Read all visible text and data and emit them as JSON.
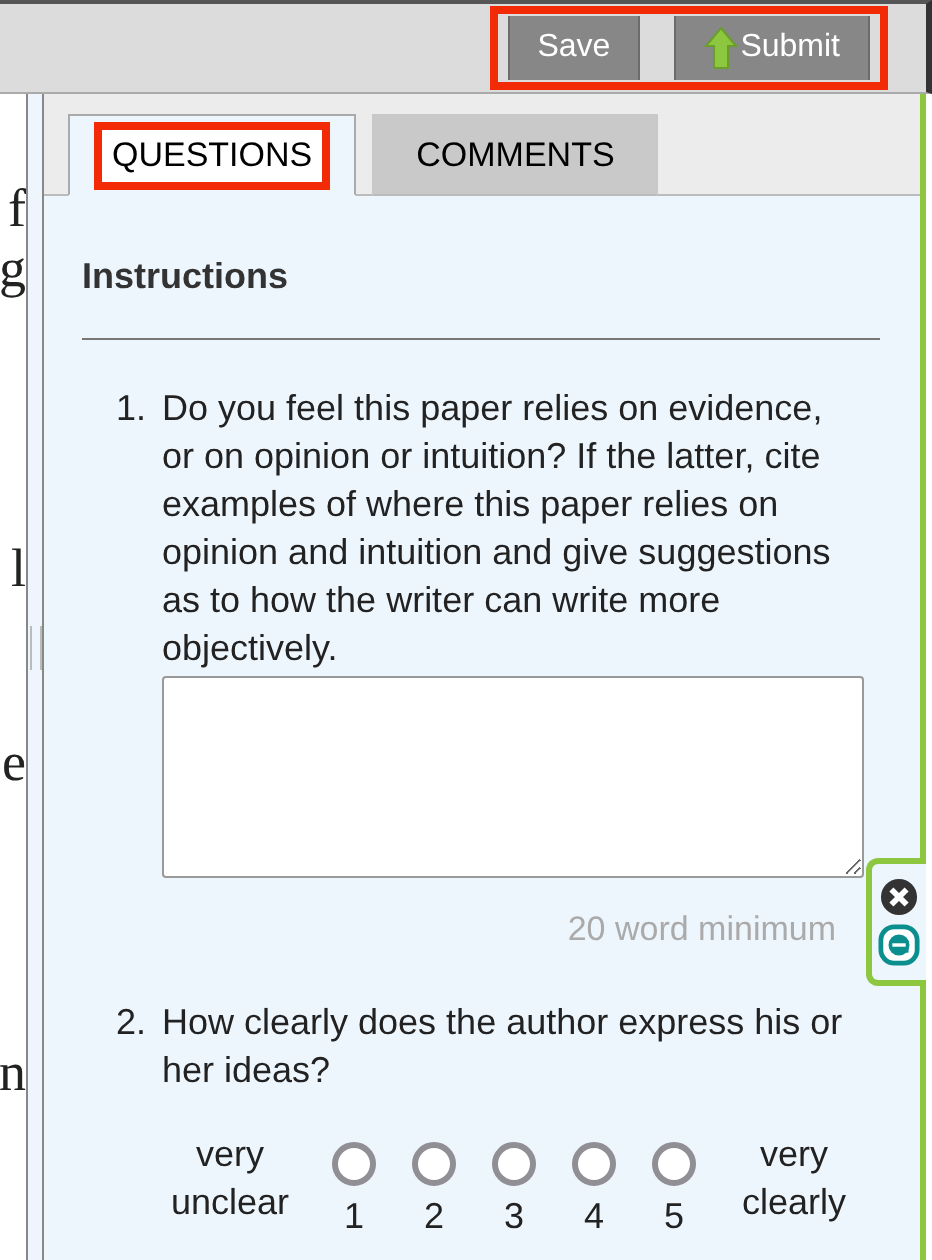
{
  "toolbar": {
    "buttons": [
      {
        "label": "Save",
        "kind": "plain"
      },
      {
        "label": "Submit",
        "kind": "upload"
      }
    ]
  },
  "document_fragments": [
    "f",
    "g",
    "l",
    "e",
    "n"
  ],
  "tabs": [
    {
      "label": "QUESTIONS",
      "selected": true
    },
    {
      "label": "COMMENTS",
      "selected": false
    }
  ],
  "heading": "Instructions",
  "questions": [
    {
      "number": "1.",
      "text": "Do you feel this paper relies on evidence, or on opinion or intuition? If the latter, cite examples of where this paper relies on opinion and intuition and give suggestions as to how the writer can write more objectively.",
      "kind": "text",
      "hint": "20 word minimum"
    },
    {
      "number": "2.",
      "text": "How clearly does the author express his or her ideas?",
      "kind": "scale",
      "low_label": "very unclear",
      "high_label": "very clearly",
      "options": [
        {
          "label": "1",
          "selected": false
        },
        {
          "label": "2",
          "selected": false
        },
        {
          "label": "3",
          "selected": false
        },
        {
          "label": "4",
          "selected": false
        },
        {
          "label": "5",
          "selected": false
        }
      ]
    }
  ]
}
